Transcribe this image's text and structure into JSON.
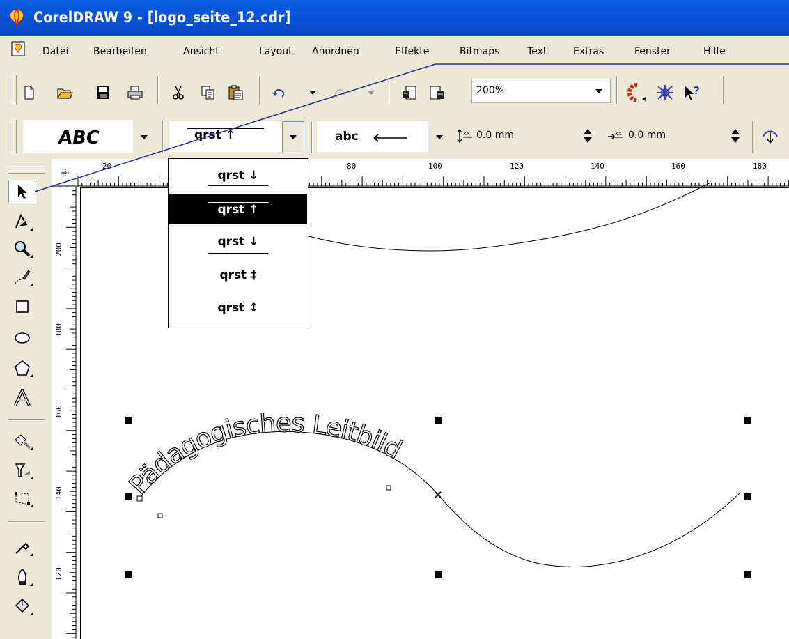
{
  "window": {
    "title": "CorelDRAW 9 - [logo_seite_12.cdr]"
  },
  "menubar": {
    "items": [
      "Datei",
      "Bearbeiten",
      "Ansicht",
      "Layout",
      "Anordnen",
      "Effekte",
      "Bitmaps",
      "Text",
      "Extras",
      "Fenster",
      "Hilfe"
    ]
  },
  "standard_toolbar": {
    "zoom_value": "200%"
  },
  "text_toolbar": {
    "shape_preview": "ABC",
    "orientation_selected": "qrst ↑",
    "placement_label": "abc",
    "horizontal_offset": "0.0 mm",
    "distance_from_path": "0.0 mm"
  },
  "orientation_dropdown": {
    "options": [
      "qrst ↓",
      "qrst ↑",
      "qrst ↓",
      "qrst ‡",
      "qrst ↕"
    ],
    "selected_index": 1
  },
  "ruler": {
    "horizontal_labels": [
      "20",
      "80",
      "100",
      "120",
      "140",
      "160",
      "180"
    ],
    "vertical_labels": [
      "200",
      "180",
      "160",
      "140",
      "120"
    ]
  },
  "canvas": {
    "curved_text": "Pädagogisches Leitbild"
  },
  "colors": {
    "title_bar": "#0a55d8",
    "chrome": "#ece9d8",
    "annotation_line": "#2a2f8a"
  }
}
